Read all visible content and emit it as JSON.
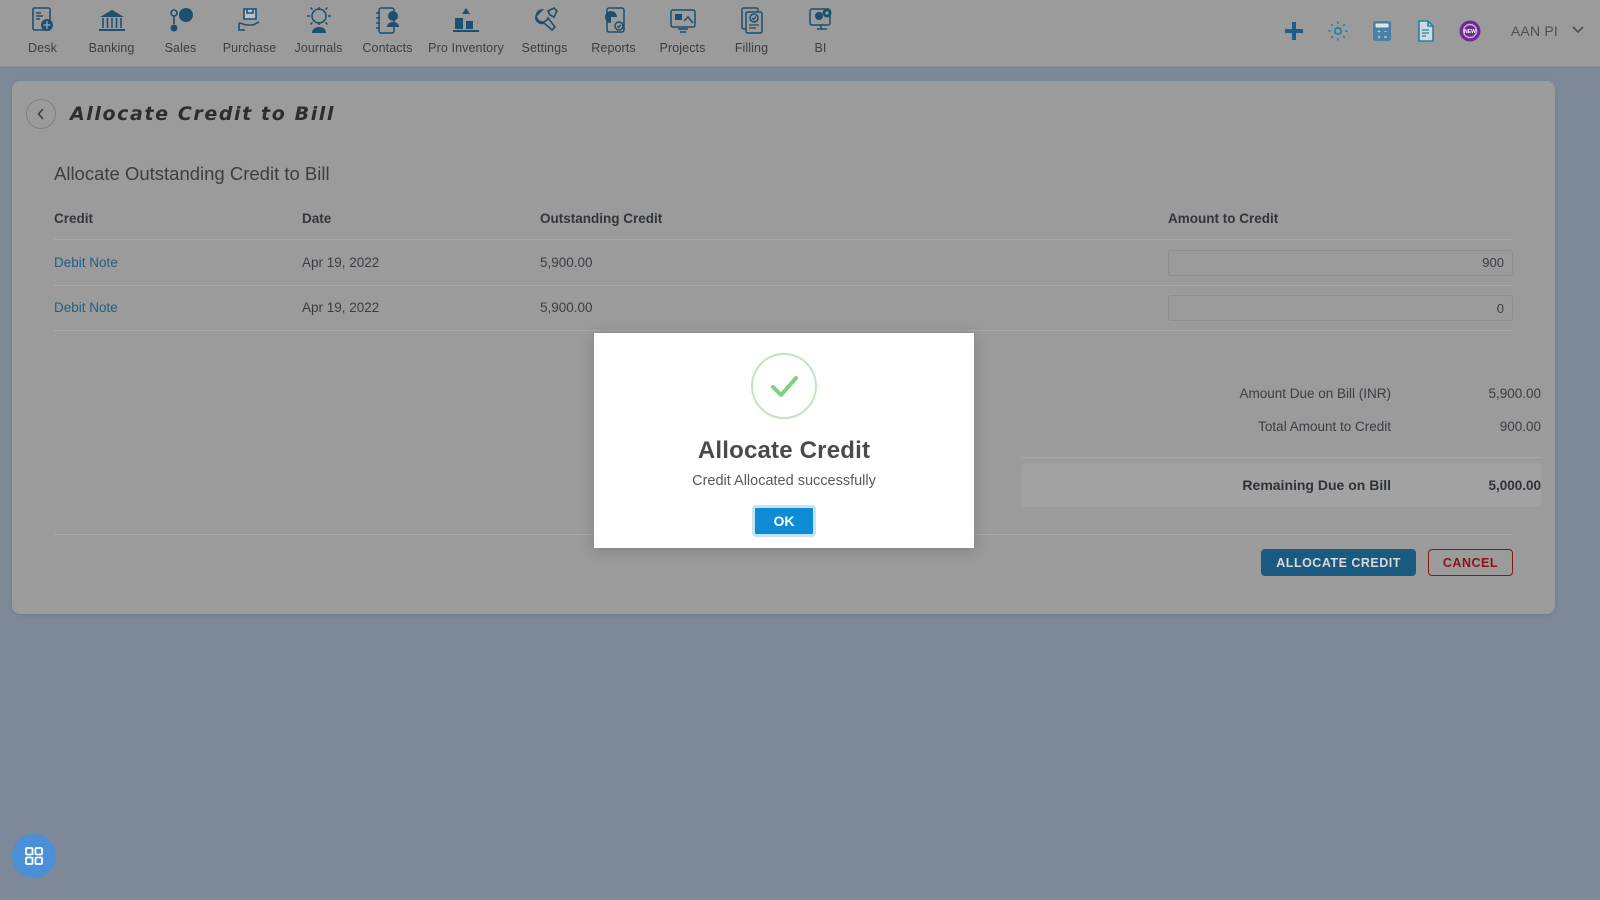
{
  "topnav": {
    "items": [
      {
        "label": "Desk",
        "icon": "desk-icon"
      },
      {
        "label": "Banking",
        "icon": "banking-icon"
      },
      {
        "label": "Sales",
        "icon": "sales-icon"
      },
      {
        "label": "Purchase",
        "icon": "purchase-icon"
      },
      {
        "label": "Journals",
        "icon": "journals-icon"
      },
      {
        "label": "Contacts",
        "icon": "contacts-icon"
      },
      {
        "label": "Pro Inventory",
        "icon": "pro-inventory-icon"
      },
      {
        "label": "Settings",
        "icon": "settings-icon"
      },
      {
        "label": "Reports",
        "icon": "reports-icon"
      },
      {
        "label": "Projects",
        "icon": "projects-icon"
      },
      {
        "label": "Filling",
        "icon": "filling-icon"
      },
      {
        "label": "BI",
        "icon": "bi-icon"
      }
    ],
    "right_icons": [
      {
        "name": "add-icon"
      },
      {
        "name": "gear-icon"
      },
      {
        "name": "calculator-icon"
      },
      {
        "name": "document-icon"
      },
      {
        "name": "new-badge-icon"
      }
    ],
    "user": {
      "name": "AAN PI",
      "chevron": "chevron-down-icon"
    }
  },
  "page": {
    "back_icon": "chevron-left-icon",
    "title": "Allocate Credit to Bill",
    "section_title": "Allocate Outstanding Credit to Bill"
  },
  "table": {
    "headers": [
      "Credit",
      "Date",
      "Outstanding Credit",
      "Amount to Credit"
    ],
    "rows": [
      {
        "credit": "Debit Note",
        "date": "Apr 19, 2022",
        "outstanding": "5,900.00",
        "amount": "900"
      },
      {
        "credit": "Debit Note",
        "date": "Apr 19, 2022",
        "outstanding": "5,900.00",
        "amount": "0"
      }
    ]
  },
  "summary": {
    "amount_due_label": "Amount Due on Bill (INR)",
    "amount_due_value": "5,900.00",
    "total_credit_label": "Total Amount to Credit",
    "total_credit_value": "900.00",
    "remaining_label": "Remaining Due on Bill",
    "remaining_value": "5,000.00"
  },
  "actions": {
    "allocate_label": "ALLOCATE CREDIT",
    "cancel_label": "CANCEL"
  },
  "fab": {
    "icon": "grid-apps-icon"
  },
  "modal": {
    "icon": "success-check-icon",
    "title": "Allocate Credit",
    "message": "Credit Allocated successfully",
    "ok_label": "OK"
  },
  "colors": {
    "page_bg": "#7d8899",
    "surface": "#9b9b9b",
    "nav_icon": "#1d4f6e",
    "link": "#1f5f85",
    "primary_button": "#1a5a80",
    "cancel_red": "#8a1416",
    "modal_ok_blue": "#0e8bd5",
    "success_green": "#7ed17e",
    "fab_blue": "#4a90d9",
    "new_badge_purple": "#6b2d8e"
  }
}
